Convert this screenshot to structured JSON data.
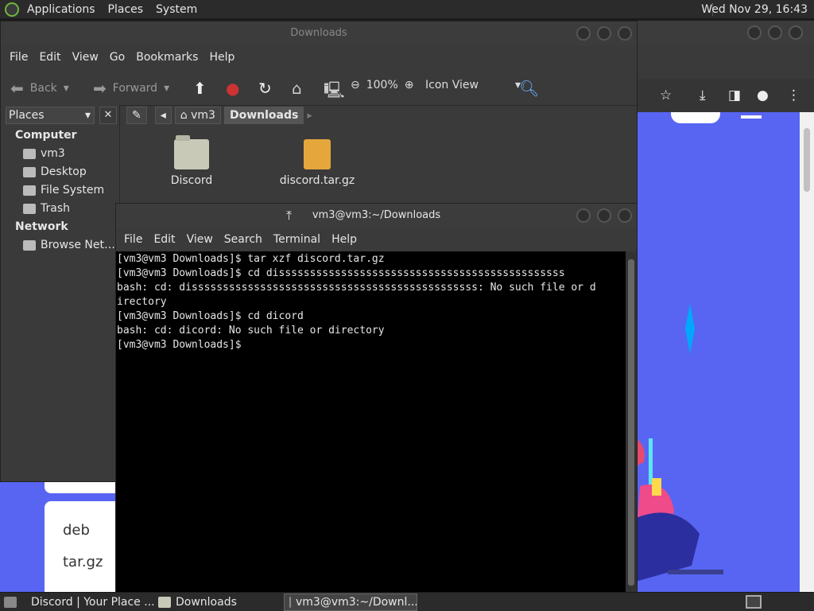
{
  "top_panel": {
    "menus": [
      "Applications",
      "Places",
      "System"
    ],
    "clock": "Wed Nov 29, 16:43"
  },
  "file_manager": {
    "title": "Downloads",
    "menu": [
      "File",
      "Edit",
      "View",
      "Go",
      "Bookmarks",
      "Help"
    ],
    "toolbar": {
      "back": "Back",
      "forward": "Forward",
      "zoom": "100%",
      "view_mode": "Icon View"
    },
    "sidebar": {
      "selector": "Places",
      "groups": [
        {
          "label": "Computer",
          "items": [
            "vm3",
            "Desktop",
            "File System",
            "Trash"
          ]
        },
        {
          "label": "Network",
          "items": [
            "Browse Net…"
          ]
        }
      ]
    },
    "path": [
      "vm3",
      "Downloads"
    ],
    "files": [
      {
        "name": "Discord",
        "kind": "folder"
      },
      {
        "name": "discord.tar.gz",
        "kind": "archive"
      }
    ]
  },
  "terminal": {
    "title": "vm3@vm3:~/Downloads",
    "menu": [
      "File",
      "Edit",
      "View",
      "Search",
      "Terminal",
      "Help"
    ],
    "lines": [
      "[vm3@vm3 Downloads]$ tar xzf discord.tar.gz",
      "[vm3@vm3 Downloads]$ cd dissssssssssssssssssssssssssssssssssssssssssssss",
      "bash: cd: dissssssssssssssssssssssssssssssssssssssssssssss: No such file or d",
      "irectory",
      "[vm3@vm3 Downloads]$ cd dicord",
      "bash: cd: dicord: No such file or directory",
      "[vm3@vm3 Downloads]$ "
    ]
  },
  "background_page": {
    "options": [
      "deb",
      "tar.gz"
    ]
  },
  "taskbar": {
    "items": [
      {
        "label": "Discord | Your Place ...",
        "active": false
      },
      {
        "label": "Downloads",
        "active": false
      },
      {
        "label": "vm3@vm3:~/Downl...",
        "active": true
      }
    ]
  },
  "colors": {
    "discord_blurple": "#5865f2",
    "panel": "#2b2b2b",
    "window": "#3a3a3a"
  }
}
